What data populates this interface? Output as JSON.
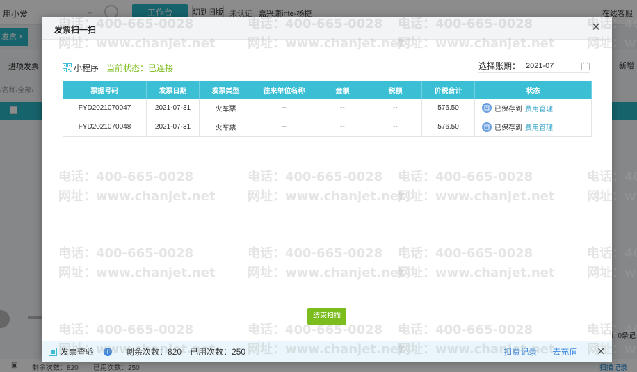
{
  "background": {
    "top_left_text": "用小爱",
    "work_button": "工作台",
    "switch_button": "切到旧版",
    "auth_text": "未认证",
    "account_text": "嘉兴康inte-杨捷",
    "cs_text": "在线客服",
    "tab_label": "发票",
    "sub_title": "进项发票",
    "sub_breadcrumb": "/名称/全部/",
    "add_text": "新增",
    "right_mini_text": "页, 0条记",
    "bottom_remaining": "剩余次数：820",
    "bottom_used": "已用次数：250",
    "bottom_records": "扫描记录"
  },
  "modal": {
    "title": "发票扫一扫",
    "mini_program_label": "小程序",
    "connection_status": "当前状态：已连接",
    "period_label": "选择账期：",
    "period_value": "2021-07",
    "table": {
      "headers": [
        "票据号码",
        "发票日期",
        "发票类型",
        "往来单位名称",
        "金额",
        "税额",
        "价税合计",
        "状态"
      ],
      "rows": [
        {
          "number": "FYD2021070047",
          "date": "2021-07-31",
          "type": "火车票",
          "partner": "--",
          "amount": "--",
          "tax": "--",
          "total": "576.50",
          "status_text": "已保存到",
          "status_link": "费用管理"
        },
        {
          "number": "FYD2021070048",
          "date": "2021-07-31",
          "type": "火车票",
          "partner": "--",
          "amount": "--",
          "tax": "--",
          "total": "576.50",
          "status_text": "已保存到",
          "status_link": "费用管理"
        }
      ]
    },
    "end_scan_button": "结束扫描",
    "footer": {
      "check_label": "发票查验",
      "remaining_label": "剩余次数：",
      "remaining_value": "820",
      "used_label": "已用次数：",
      "used_value": "250",
      "records_link": "扣费记录",
      "recharge_link": "去充值"
    }
  },
  "watermark": {
    "phone": "电话：400-665-0028",
    "site": "网址：www.chanjet.net"
  },
  "colors": {
    "accent": "#3bbfd5",
    "green": "#7cbd1e",
    "link_blue": "#3b86de"
  },
  "icons": [
    "qr-code-icon",
    "calendar-icon",
    "close-icon",
    "info-icon",
    "saved-icon",
    "invoice-check-icon"
  ]
}
